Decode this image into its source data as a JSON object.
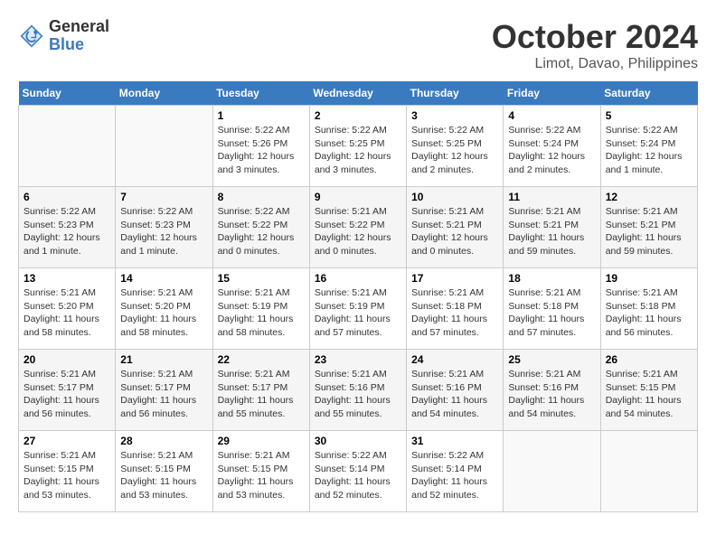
{
  "header": {
    "logo_general": "General",
    "logo_blue": "Blue",
    "month": "October 2024",
    "location": "Limot, Davao, Philippines"
  },
  "weekdays": [
    "Sunday",
    "Monday",
    "Tuesday",
    "Wednesday",
    "Thursday",
    "Friday",
    "Saturday"
  ],
  "weeks": [
    [
      {
        "day": "",
        "info": ""
      },
      {
        "day": "",
        "info": ""
      },
      {
        "day": "1",
        "info": "Sunrise: 5:22 AM\nSunset: 5:26 PM\nDaylight: 12 hours\nand 3 minutes."
      },
      {
        "day": "2",
        "info": "Sunrise: 5:22 AM\nSunset: 5:25 PM\nDaylight: 12 hours\nand 3 minutes."
      },
      {
        "day": "3",
        "info": "Sunrise: 5:22 AM\nSunset: 5:25 PM\nDaylight: 12 hours\nand 2 minutes."
      },
      {
        "day": "4",
        "info": "Sunrise: 5:22 AM\nSunset: 5:24 PM\nDaylight: 12 hours\nand 2 minutes."
      },
      {
        "day": "5",
        "info": "Sunrise: 5:22 AM\nSunset: 5:24 PM\nDaylight: 12 hours\nand 1 minute."
      }
    ],
    [
      {
        "day": "6",
        "info": "Sunrise: 5:22 AM\nSunset: 5:23 PM\nDaylight: 12 hours\nand 1 minute."
      },
      {
        "day": "7",
        "info": "Sunrise: 5:22 AM\nSunset: 5:23 PM\nDaylight: 12 hours\nand 1 minute."
      },
      {
        "day": "8",
        "info": "Sunrise: 5:22 AM\nSunset: 5:22 PM\nDaylight: 12 hours\nand 0 minutes."
      },
      {
        "day": "9",
        "info": "Sunrise: 5:21 AM\nSunset: 5:22 PM\nDaylight: 12 hours\nand 0 minutes."
      },
      {
        "day": "10",
        "info": "Sunrise: 5:21 AM\nSunset: 5:21 PM\nDaylight: 12 hours\nand 0 minutes."
      },
      {
        "day": "11",
        "info": "Sunrise: 5:21 AM\nSunset: 5:21 PM\nDaylight: 11 hours\nand 59 minutes."
      },
      {
        "day": "12",
        "info": "Sunrise: 5:21 AM\nSunset: 5:21 PM\nDaylight: 11 hours\nand 59 minutes."
      }
    ],
    [
      {
        "day": "13",
        "info": "Sunrise: 5:21 AM\nSunset: 5:20 PM\nDaylight: 11 hours\nand 58 minutes."
      },
      {
        "day": "14",
        "info": "Sunrise: 5:21 AM\nSunset: 5:20 PM\nDaylight: 11 hours\nand 58 minutes."
      },
      {
        "day": "15",
        "info": "Sunrise: 5:21 AM\nSunset: 5:19 PM\nDaylight: 11 hours\nand 58 minutes."
      },
      {
        "day": "16",
        "info": "Sunrise: 5:21 AM\nSunset: 5:19 PM\nDaylight: 11 hours\nand 57 minutes."
      },
      {
        "day": "17",
        "info": "Sunrise: 5:21 AM\nSunset: 5:18 PM\nDaylight: 11 hours\nand 57 minutes."
      },
      {
        "day": "18",
        "info": "Sunrise: 5:21 AM\nSunset: 5:18 PM\nDaylight: 11 hours\nand 57 minutes."
      },
      {
        "day": "19",
        "info": "Sunrise: 5:21 AM\nSunset: 5:18 PM\nDaylight: 11 hours\nand 56 minutes."
      }
    ],
    [
      {
        "day": "20",
        "info": "Sunrise: 5:21 AM\nSunset: 5:17 PM\nDaylight: 11 hours\nand 56 minutes."
      },
      {
        "day": "21",
        "info": "Sunrise: 5:21 AM\nSunset: 5:17 PM\nDaylight: 11 hours\nand 56 minutes."
      },
      {
        "day": "22",
        "info": "Sunrise: 5:21 AM\nSunset: 5:17 PM\nDaylight: 11 hours\nand 55 minutes."
      },
      {
        "day": "23",
        "info": "Sunrise: 5:21 AM\nSunset: 5:16 PM\nDaylight: 11 hours\nand 55 minutes."
      },
      {
        "day": "24",
        "info": "Sunrise: 5:21 AM\nSunset: 5:16 PM\nDaylight: 11 hours\nand 54 minutes."
      },
      {
        "day": "25",
        "info": "Sunrise: 5:21 AM\nSunset: 5:16 PM\nDaylight: 11 hours\nand 54 minutes."
      },
      {
        "day": "26",
        "info": "Sunrise: 5:21 AM\nSunset: 5:15 PM\nDaylight: 11 hours\nand 54 minutes."
      }
    ],
    [
      {
        "day": "27",
        "info": "Sunrise: 5:21 AM\nSunset: 5:15 PM\nDaylight: 11 hours\nand 53 minutes."
      },
      {
        "day": "28",
        "info": "Sunrise: 5:21 AM\nSunset: 5:15 PM\nDaylight: 11 hours\nand 53 minutes."
      },
      {
        "day": "29",
        "info": "Sunrise: 5:21 AM\nSunset: 5:15 PM\nDaylight: 11 hours\nand 53 minutes."
      },
      {
        "day": "30",
        "info": "Sunrise: 5:22 AM\nSunset: 5:14 PM\nDaylight: 11 hours\nand 52 minutes."
      },
      {
        "day": "31",
        "info": "Sunrise: 5:22 AM\nSunset: 5:14 PM\nDaylight: 11 hours\nand 52 minutes."
      },
      {
        "day": "",
        "info": ""
      },
      {
        "day": "",
        "info": ""
      }
    ]
  ]
}
